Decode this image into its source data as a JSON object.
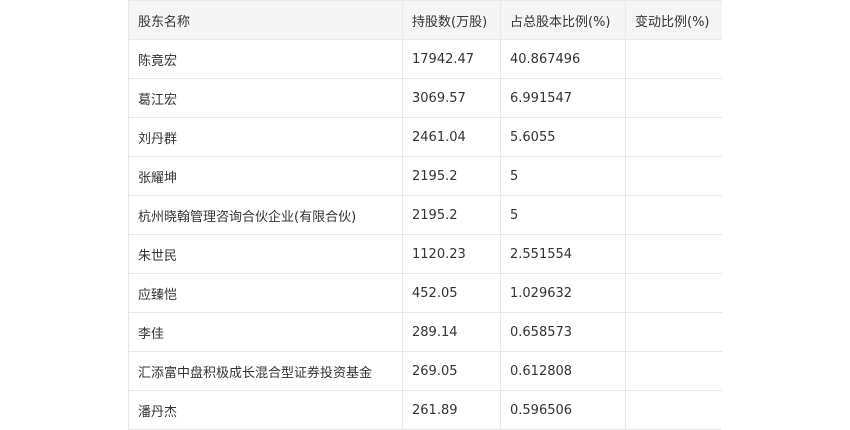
{
  "table": {
    "headers": [
      "股东名称",
      "持股数(万股)",
      "占总股本比例(%)",
      "变动比例(%)"
    ],
    "rows": [
      [
        "陈竟宏",
        "17942.47",
        "40.867496",
        ""
      ],
      [
        "葛江宏",
        "3069.57",
        "6.991547",
        ""
      ],
      [
        "刘丹群",
        "2461.04",
        "5.6055",
        ""
      ],
      [
        "张耀坤",
        "2195.2",
        "5",
        ""
      ],
      [
        "杭州晓翰管理咨询合伙企业(有限合伙)",
        "2195.2",
        "5",
        ""
      ],
      [
        "朱世民",
        "1120.23",
        "2.551554",
        ""
      ],
      [
        "应臻恺",
        "452.05",
        "1.029632",
        ""
      ],
      [
        "李佳",
        "289.14",
        "0.658573",
        ""
      ],
      [
        "汇添富中盘积极成长混合型证券投资基金",
        "269.05",
        "0.612808",
        ""
      ],
      [
        "潘丹杰",
        "261.89",
        "0.596506",
        ""
      ]
    ]
  }
}
